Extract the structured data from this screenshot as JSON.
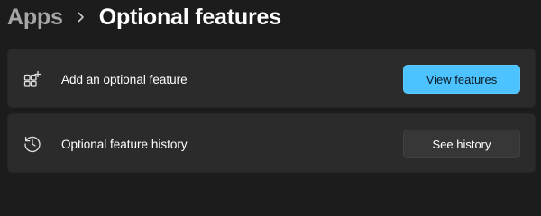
{
  "breadcrumb": {
    "parent": "Apps",
    "separator_icon": "chevron-right-icon",
    "current": "Optional features"
  },
  "cards": [
    {
      "icon": "add-apps-icon",
      "label": "Add an optional feature",
      "button_label": "View features"
    },
    {
      "icon": "history-icon",
      "label": "Optional feature history",
      "button_label": "See history"
    }
  ],
  "colors": {
    "background": "#1c1c1c",
    "card": "#2b2b2b",
    "accent": "#4cc2ff",
    "secondary_button": "#373737",
    "muted_text": "#a6a6a6"
  }
}
